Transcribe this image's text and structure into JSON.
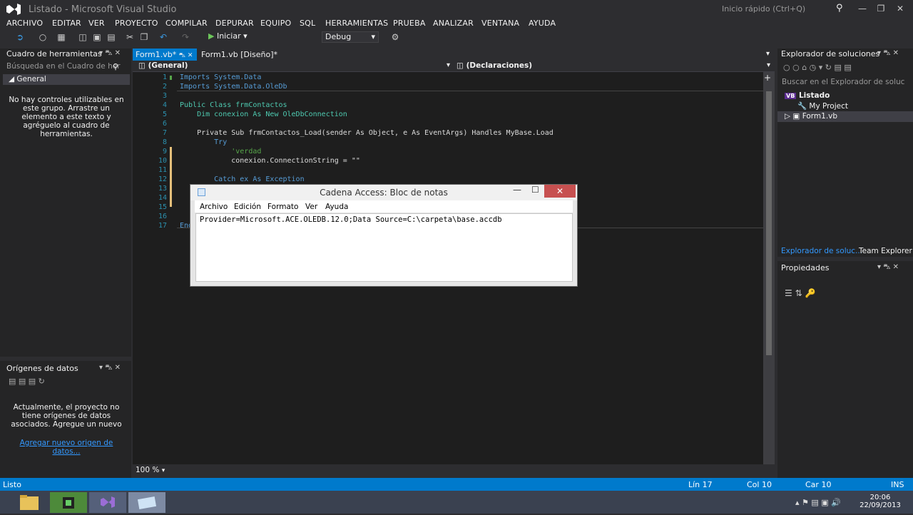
{
  "window": {
    "title": "Listado - Microsoft Visual Studio",
    "quick_launch": "Inicio rápido (Ctrl+Q)"
  },
  "menu": [
    "ARCHIVO",
    "EDITAR",
    "VER",
    "PROYECTO",
    "COMPILAR",
    "DEPURAR",
    "EQUIPO",
    "SQL",
    "HERRAMIENTAS",
    "PRUEBA",
    "ANALIZAR",
    "VENTANA",
    "AYUDA"
  ],
  "toolbar": {
    "start_label": "Iniciar",
    "config": "Debug"
  },
  "toolbox": {
    "title": "Cuadro de herramientas",
    "search": "Búsqueda en el Cuadro de her",
    "group": "General",
    "empty_msg": "No hay controles utilizables en este grupo. Arrastre un elemento a este texto y agréguelo al cuadro de herramientas."
  },
  "datasources": {
    "title": "Orígenes de datos",
    "msg": "Actualmente, el proyecto no tiene orígenes de datos asociados. Agregue un nuevo",
    "link": "Agregar nuevo origen de datos..."
  },
  "tabs": [
    {
      "label": "Form1.vb*"
    },
    {
      "label": "Form1.vb [Diseño]*"
    }
  ],
  "editor": {
    "scope_left": "(General)",
    "scope_right": "(Declaraciones)",
    "zoom": "100 %"
  },
  "code": [
    {
      "n": "1",
      "t": "Imports System.Data"
    },
    {
      "n": "2",
      "t": "Imports System.Data.OleDb"
    },
    {
      "n": "3",
      "t": ""
    },
    {
      "n": "4",
      "t": "Public Class frmContactos"
    },
    {
      "n": "5",
      "t": "    Dim conexion As New OleDbConnection"
    },
    {
      "n": "6",
      "t": ""
    },
    {
      "n": "7",
      "t": "    Private Sub frmContactos_Load(sender As Object, e As EventArgs) Handles MyBase.Load"
    },
    {
      "n": "8",
      "t": "        Try"
    },
    {
      "n": "9",
      "t": "            'verdad"
    },
    {
      "n": "10",
      "t": "            conexion.ConnectionString = \"\""
    },
    {
      "n": "11",
      "t": ""
    },
    {
      "n": "12",
      "t": "        Catch ex As Exception"
    },
    {
      "n": "13",
      "t": ""
    },
    {
      "n": "14",
      "t": ""
    },
    {
      "n": "15",
      "t": ""
    },
    {
      "n": "16",
      "t": ""
    },
    {
      "n": "17",
      "t": "End"
    }
  ],
  "solution": {
    "title": "Explorador de soluciones",
    "search": "Buscar en el Explorador de soluc",
    "root": "Listado",
    "items": [
      "My Project",
      "Form1.vb"
    ],
    "tab1": "Explorador de soluc...",
    "tab2": "Team Explorer"
  },
  "properties": {
    "title": "Propiedades"
  },
  "notepad": {
    "title": "Cadena Access: Bloc de notas",
    "menu": [
      "Archivo",
      "Edición",
      "Formato",
      "Ver",
      "Ayuda"
    ],
    "content": "Provider=Microsoft.ACE.OLEDB.12.0;Data Source=C:\\carpeta\\base.accdb"
  },
  "status": {
    "ready": "Listo",
    "line": "Lín 17",
    "col": "Col 10",
    "car": "Car 10",
    "mode": "INS"
  },
  "clock": {
    "time": "20:06",
    "date": "22/09/2013"
  },
  "colors": {
    "accent": "#007acc",
    "bg": "#2d2d30"
  }
}
